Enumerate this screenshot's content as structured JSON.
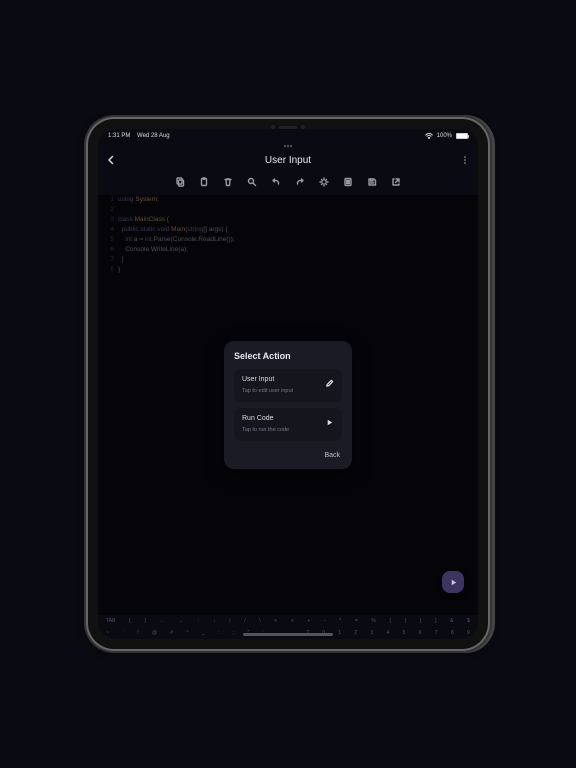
{
  "status": {
    "time": "1:31 PM",
    "date": "Wed 28 Aug",
    "battery": "100%"
  },
  "header": {
    "title": "User Input"
  },
  "code": {
    "lines": [
      {
        "n": "1",
        "html": "<span class='kw'>using</span> <span class='cls'>System</span>;"
      },
      {
        "n": "2",
        "html": ""
      },
      {
        "n": "3",
        "html": "<span class='kw'>class</span> <span class='cls'>MainClass</span> {"
      },
      {
        "n": "4",
        "html": "  <span class='kw'>public static void</span> <span class='fn'>Main</span>(<span class='typ'>string</span>[] args) {"
      },
      {
        "n": "5",
        "html": "    <span class='typ'>int</span> a = <span class='typ'>int</span>.Parse(Console.ReadLine());"
      },
      {
        "n": "6",
        "html": "    Console.WriteLine(a);"
      },
      {
        "n": "7",
        "html": "  }"
      },
      {
        "n": "8",
        "html": "}"
      }
    ]
  },
  "modal": {
    "title": "Select Action",
    "item1": {
      "title": "User Input",
      "sub": "Tap to edit user input"
    },
    "item2": {
      "title": "Run Code",
      "sub": "Tap to run the code"
    },
    "back": "Back"
  },
  "toolbar_icons": [
    "copy",
    "paste",
    "delete",
    "search",
    "undo",
    "redo",
    "format",
    "toggle",
    "save",
    "open-external"
  ],
  "keyrow1": [
    "TAB",
    "{",
    "}",
    "←",
    "→",
    "↑",
    "↓",
    "|",
    "/",
    "\\",
    "<",
    ">",
    "+",
    "-",
    "*",
    "=",
    "%",
    "(",
    ")",
    "[",
    "]",
    "&",
    "$"
  ],
  "keyrow2": [
    "~",
    "`",
    "!",
    "@",
    "#",
    "^",
    "_",
    ":",
    ";",
    "\"",
    "'",
    ",",
    ".",
    "?",
    "0",
    "1",
    "2",
    "3",
    "4",
    "5",
    "6",
    "7",
    "8",
    "9"
  ]
}
